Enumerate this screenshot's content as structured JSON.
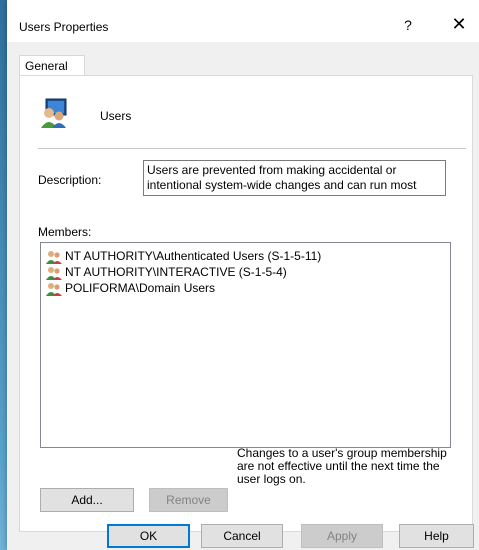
{
  "window": {
    "title": "Users Properties",
    "help_label": "?",
    "close_label": "✕"
  },
  "tabs": [
    {
      "label": "General"
    }
  ],
  "general": {
    "group_name": "Users",
    "description_label": "Description:",
    "description_value": "Users are prevented from making accidental or intentional system-wide changes and can run most",
    "members_label": "Members:",
    "members": [
      {
        "name": "NT AUTHORITY\\Authenticated Users (S-1-5-11)",
        "icon": "group-icon"
      },
      {
        "name": "NT AUTHORITY\\INTERACTIVE (S-1-5-4)",
        "icon": "group-icon"
      },
      {
        "name": "POLIFORMA\\Domain Users",
        "icon": "group-icon"
      }
    ],
    "add_label": "Add...",
    "remove_label": "Remove",
    "info_text": "Changes to a user's group membership are not effective until the next time the user logs on."
  },
  "footer": {
    "ok_label": "OK",
    "cancel_label": "Cancel",
    "apply_label": "Apply",
    "help_label": "Help"
  },
  "colors": {
    "accent": "#0078d7",
    "dialog_bg": "#f0f0f0",
    "disabled_text": "#838383"
  }
}
